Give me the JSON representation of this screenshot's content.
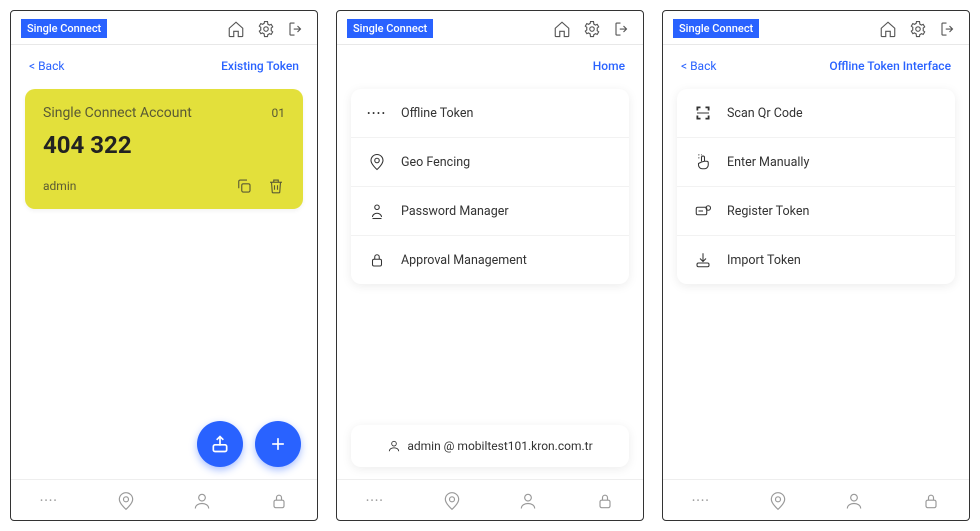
{
  "brand": "Single Connect",
  "icons": {
    "home": "home-icon",
    "settings": "gear-icon",
    "logout": "exit-icon"
  },
  "screen1": {
    "back": "< Back",
    "subtitle": "Existing Token",
    "token": {
      "title": "Single Connect Account",
      "index": "01",
      "code": "404 322",
      "user": "admin"
    }
  },
  "screen2": {
    "subtitle": "Home",
    "menu": [
      {
        "label": "Offline Token"
      },
      {
        "label": "Geo Fencing"
      },
      {
        "label": "Password Manager"
      },
      {
        "label": "Approval Management"
      }
    ],
    "user_line": "admin @ mobiltest101.kron.com.tr"
  },
  "screen3": {
    "back": "< Back",
    "subtitle": "Offline Token Interface",
    "menu": [
      {
        "label": "Scan Qr Code"
      },
      {
        "label": "Enter Manually"
      },
      {
        "label": "Register Token"
      },
      {
        "label": "Import Token"
      }
    ]
  },
  "bottomnav": [
    "offline-token",
    "geo-fencing",
    "password-manager",
    "approval-management"
  ]
}
